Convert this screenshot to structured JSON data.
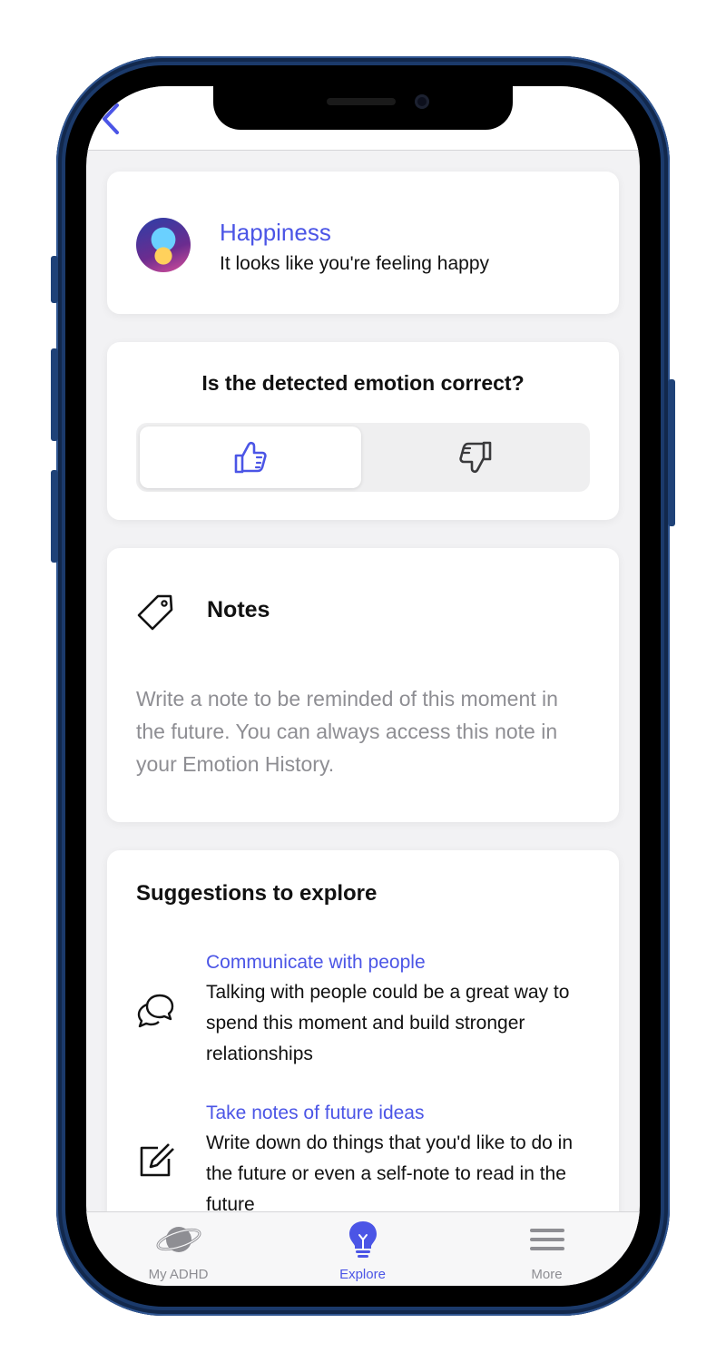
{
  "emotion": {
    "name": "Happiness",
    "description": "It looks like you're feeling happy"
  },
  "feedback": {
    "question": "Is the detected emotion correct?",
    "options": [
      "thumbs-up-icon",
      "thumbs-down-icon"
    ],
    "selected": "thumbs-up"
  },
  "notes": {
    "title": "Notes",
    "placeholder": "Write a note to be reminded of this moment in the future. You can always access this note in your Emotion History."
  },
  "suggestions": {
    "title": "Suggestions to explore",
    "items": [
      {
        "icon": "chat-bubbles-icon",
        "label": "Communicate with people",
        "description": "Talking with people could be a great way to spend this moment and build stronger relationships"
      },
      {
        "icon": "edit-note-icon",
        "label": "Take notes of future ideas",
        "description": "Write down do things that you'd like to do in the future or even a self-note to read in the future"
      }
    ]
  },
  "tabs": [
    {
      "label": "My ADHD",
      "icon": "planet-icon",
      "active": false
    },
    {
      "label": "Explore",
      "icon": "lightbulb-icon",
      "active": true
    },
    {
      "label": "More",
      "icon": "menu-icon",
      "active": false
    }
  ],
  "colors": {
    "accent": "#4b55e6",
    "inactive": "#8e8e93",
    "frame": "#1b3a6b"
  }
}
